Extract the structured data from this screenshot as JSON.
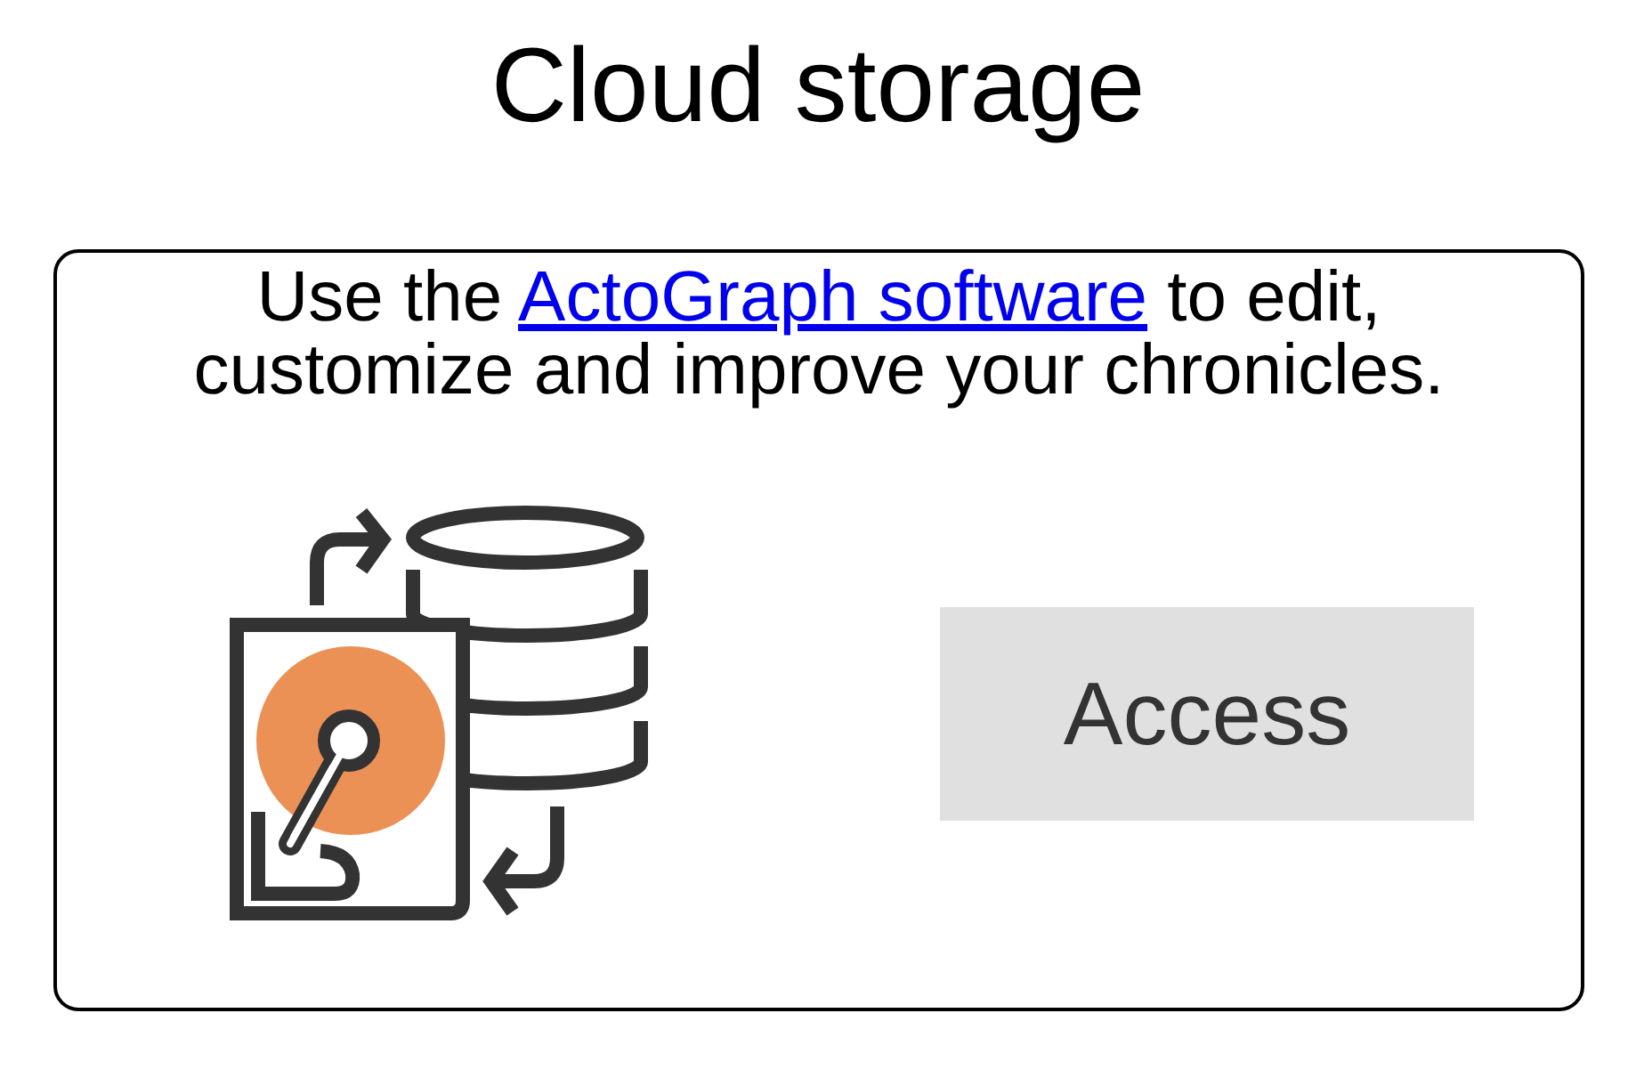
{
  "title": "Cloud storage",
  "card": {
    "description": {
      "before": "Use the ",
      "link": "ActoGraph software",
      "after": " to edit, customize and improve your chronicles."
    },
    "button": "Access"
  }
}
